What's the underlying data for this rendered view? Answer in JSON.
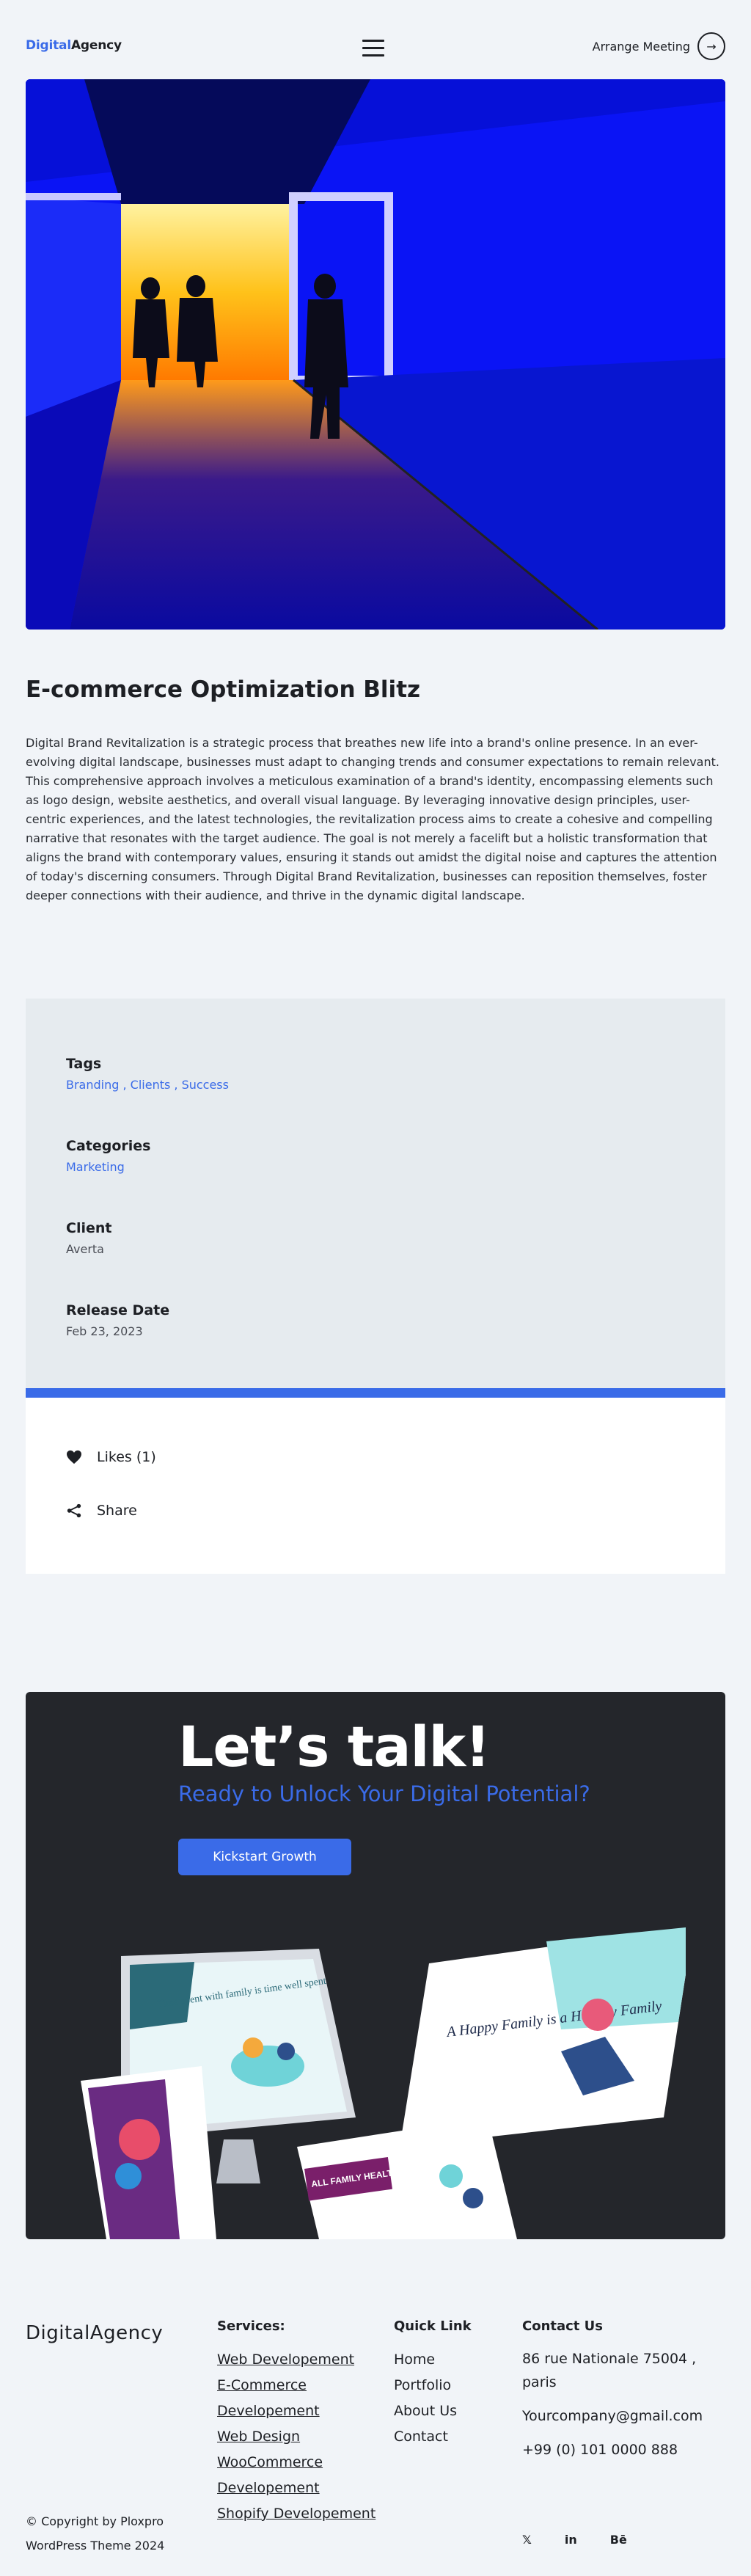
{
  "header": {
    "logo_accent": "Digital",
    "logo_rest": "Agency",
    "menu_icon": "hamburger-icon",
    "meeting_label": "Arrange Meeting",
    "meeting_icon": "arrow-right-icon",
    "meeting_arrow": "→"
  },
  "project": {
    "title": "E-commerce Optimization Blitz",
    "description": "Digital Brand Revitalization is a strategic process that breathes new life into a brand's online presence. In an ever-evolving digital landscape, businesses must adapt to changing trends and consumer expectations to remain relevant. This comprehensive approach involves a meticulous examination of a brand's identity, encompassing elements such as logo design, website aesthetics, and overall visual language. By leveraging innovative design principles, user-centric experiences, and the latest technologies, the revitalization process aims to create a cohesive and compelling narrative that resonates with the target audience. The goal is not merely a facelift but a holistic transformation that aligns the brand with contemporary values, ensuring it stands out amidst the digital noise and captures the attention of today's discerning consumers. Through Digital Brand Revitalization, businesses can reposition themselves, foster deeper connections with their audience, and thrive in the dynamic digital landscape."
  },
  "meta": {
    "tags_label": "Tags",
    "tags_value": "Branding , Clients , Success",
    "categories_label": "Categories",
    "categories_value": "Marketing",
    "client_label": "Client",
    "client_value": "Averta",
    "release_label": "Release Date",
    "release_value": "Feb 23, 2023"
  },
  "actions": {
    "likes_label": "Likes (1)",
    "likes_icon": "heart-icon",
    "share_label": "Share",
    "share_icon": "share-icon"
  },
  "cta": {
    "heading": "Let’s talk!",
    "subheading": "Ready to Unlock Your Digital Potential?",
    "button_label": "Kickstart Growth",
    "art_text_1": "Time spent with family is time well spent",
    "art_text_2": "A Happy Family is a Healthy Family",
    "art_text_3": "ALL FAMILY HEALTH CLINIC"
  },
  "footer": {
    "logo": "DigitalAgency",
    "services_title": "Services:",
    "services": [
      "Web Developement",
      "E-Commerce Developement",
      "Web Design",
      "WooCommerce Developement",
      "Shopify Developement"
    ],
    "quick_title": "Quick Link",
    "quick_links": [
      "Home",
      "Portfolio",
      "About Us",
      "Contact"
    ],
    "contact_title": "Contact Us",
    "address": "86 rue Nationale 75004 , paris",
    "email": "Yourcompany@gmail.com",
    "phone": "+99 (0) 101 0000 888",
    "copyright": "© Copyright by Ploxpro WordPress Theme 2024",
    "socials": [
      {
        "icon": "twitter-icon",
        "glyph": "𝕏"
      },
      {
        "icon": "linkedin-icon",
        "glyph": "in"
      },
      {
        "icon": "behance-icon",
        "glyph": "Bē"
      }
    ]
  },
  "colors": {
    "accent": "#3a6be8",
    "dark": "#24262b",
    "page_bg": "#f1f4f8",
    "meta_bg": "#e6ebef"
  }
}
